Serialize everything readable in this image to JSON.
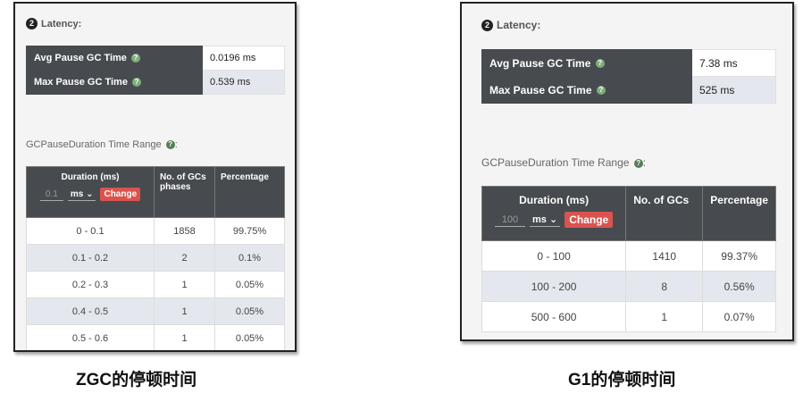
{
  "panels": [
    {
      "latency_badge": "2",
      "latency_label": "Latency:",
      "metrics": [
        {
          "label": "Avg Pause GC Time",
          "value": "0.0196 ms"
        },
        {
          "label": "Max Pause GC Time",
          "value": "0.539 ms"
        }
      ],
      "help_icon": "?",
      "range_title": "GCPauseDuration Time Range",
      "table": {
        "col_duration": "Duration (ms)",
        "col_count": "No. of GCs phases",
        "col_pct": "Percentage",
        "unit_input_value": "0.1",
        "unit_select": "ms",
        "change_label": "Change",
        "rows": [
          {
            "range": "0 - 0.1",
            "count": "1858",
            "pct": "99.75%"
          },
          {
            "range": "0.1 - 0.2",
            "count": "2",
            "pct": "0.1%"
          },
          {
            "range": "0.2 - 0.3",
            "count": "1",
            "pct": "0.05%"
          },
          {
            "range": "0.4 - 0.5",
            "count": "1",
            "pct": "0.05%"
          },
          {
            "range": "0.5 - 0.6",
            "count": "1",
            "pct": "0.05%"
          }
        ]
      },
      "caption": "ZGC的停顿时间"
    },
    {
      "latency_badge": "2",
      "latency_label": "Latency:",
      "metrics": [
        {
          "label": "Avg Pause GC Time",
          "value": "7.38 ms"
        },
        {
          "label": "Max Pause GC Time",
          "value": "525 ms"
        }
      ],
      "help_icon": "?",
      "range_title": "GCPauseDuration Time Range",
      "table": {
        "col_duration": "Duration (ms)",
        "col_count": "No. of GCs",
        "col_pct": "Percentage",
        "unit_input_value": "100",
        "unit_select": "ms",
        "change_label": "Change",
        "rows": [
          {
            "range": "0 - 100",
            "count": "1410",
            "pct": "99.37%"
          },
          {
            "range": "100 - 200",
            "count": "8",
            "pct": "0.56%"
          },
          {
            "range": "500 - 600",
            "count": "1",
            "pct": "0.07%"
          }
        ]
      },
      "caption": "G1的停顿时间"
    }
  ]
}
